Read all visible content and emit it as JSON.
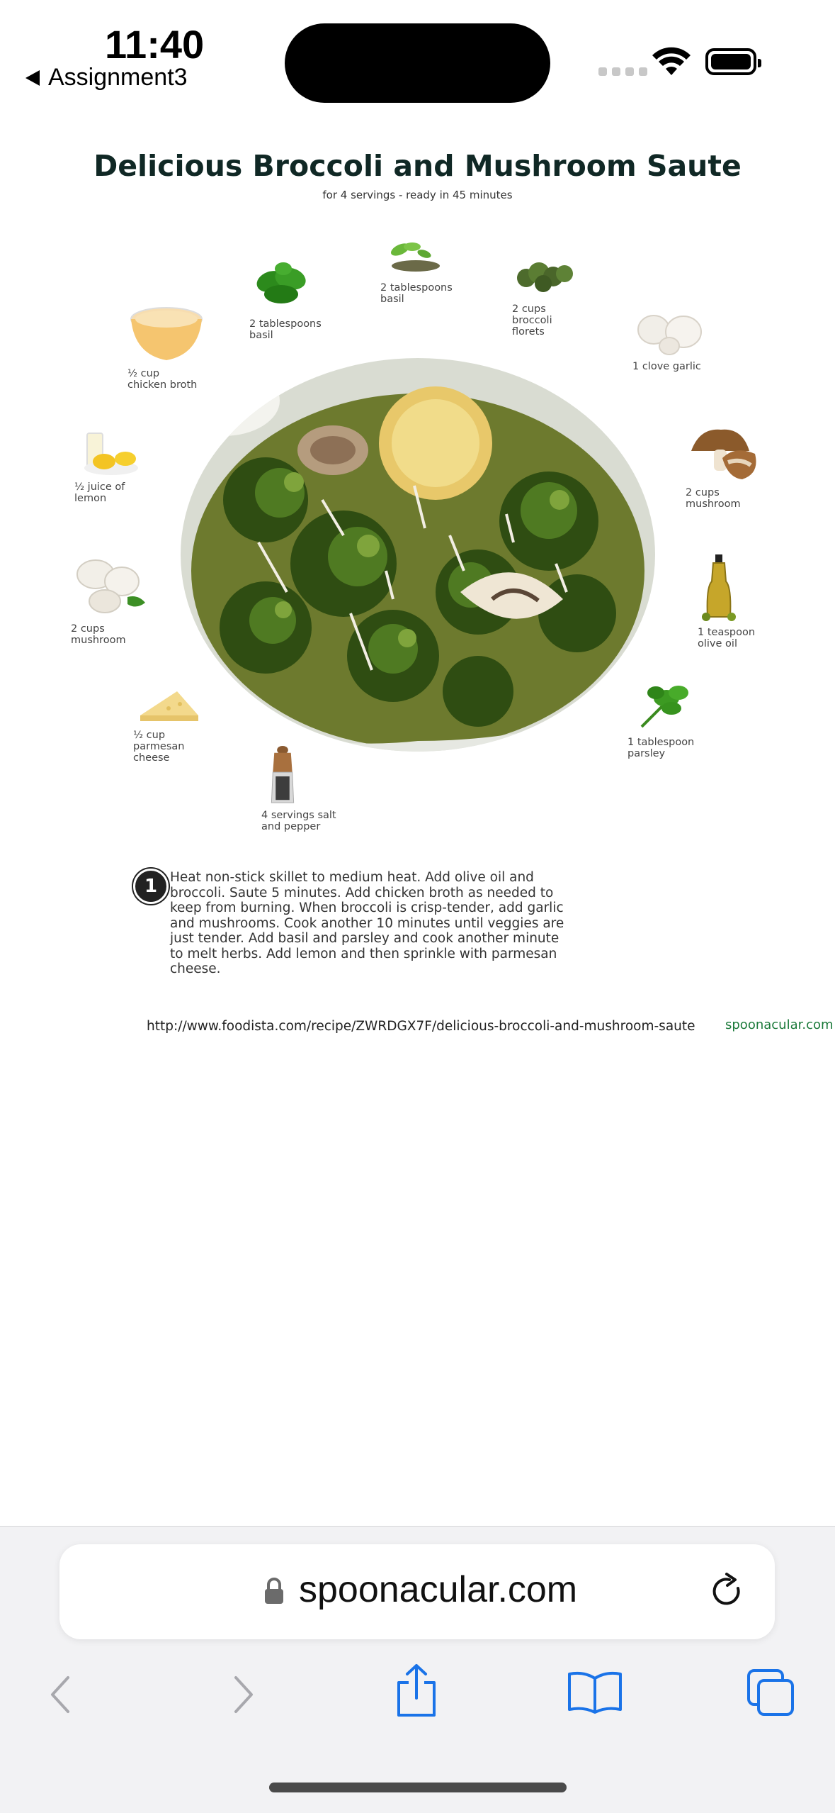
{
  "status": {
    "time": "11:40",
    "back_label": "Assignment3"
  },
  "recipe": {
    "title": "Delicious Broccoli and Mushroom Saute",
    "subtitle": "for 4 servings - ready in 45 minutes",
    "ingredients": [
      {
        "name": "basil",
        "label": "2 tablespoons\nbasil",
        "icon": "basil-leaves-icon"
      },
      {
        "name": "dried-basil",
        "label": "2 tablespoons\nbasil",
        "icon": "dried-basil-icon"
      },
      {
        "name": "broccoli",
        "label": "2 cups\nbroccoli\nflorets",
        "icon": "broccoli-icon"
      },
      {
        "name": "chicken-broth",
        "label": "½ cup\nchicken broth",
        "icon": "broth-bowl-icon"
      },
      {
        "name": "garlic",
        "label": "1 clove garlic",
        "icon": "garlic-icon"
      },
      {
        "name": "lemon",
        "label": "½  juice of\nlemon",
        "icon": "lemon-icon"
      },
      {
        "name": "mushroom-right",
        "label": "2 cups\nmushroom",
        "icon": "mushroom-icon"
      },
      {
        "name": "mushroom-left",
        "label": "2 cups\nmushroom",
        "icon": "white-mushroom-icon"
      },
      {
        "name": "olive-oil",
        "label": "1 teaspoon\nolive oil",
        "icon": "olive-oil-bottle-icon"
      },
      {
        "name": "parmesan",
        "label": "½ cup\nparmesan\ncheese",
        "icon": "parmesan-icon"
      },
      {
        "name": "parsley",
        "label": "1 tablespoon\nparsley",
        "icon": "parsley-icon"
      },
      {
        "name": "salt-pepper",
        "label": "4 servings salt\nand pepper",
        "icon": "pepper-mill-icon"
      }
    ],
    "steps": [
      {
        "number": "1",
        "text": "Heat non-stick skillet to medium heat. Add olive oil and broccoli. Saute 5 minutes. Add chicken broth as needed to keep from burning.  When broccoli is crisp-tender, add garlic and mushrooms. Cook another 10 minutes until veggies are just tender. Add basil and parsley and cook another minute to melt herbs. Add lemon and then sprinkle with parmesan cheese."
      }
    ],
    "source_url": "http://www.foodista.com/recipe/ZWRDGX7F/delicious-broccoli-and-mushroom-saute",
    "brand": "spoonacular.com"
  },
  "browser": {
    "url": "spoonacular.com"
  },
  "colors": {
    "accent_blue": "#1a73e8",
    "brand_green": "#1b7a3a",
    "title": "#102825"
  }
}
